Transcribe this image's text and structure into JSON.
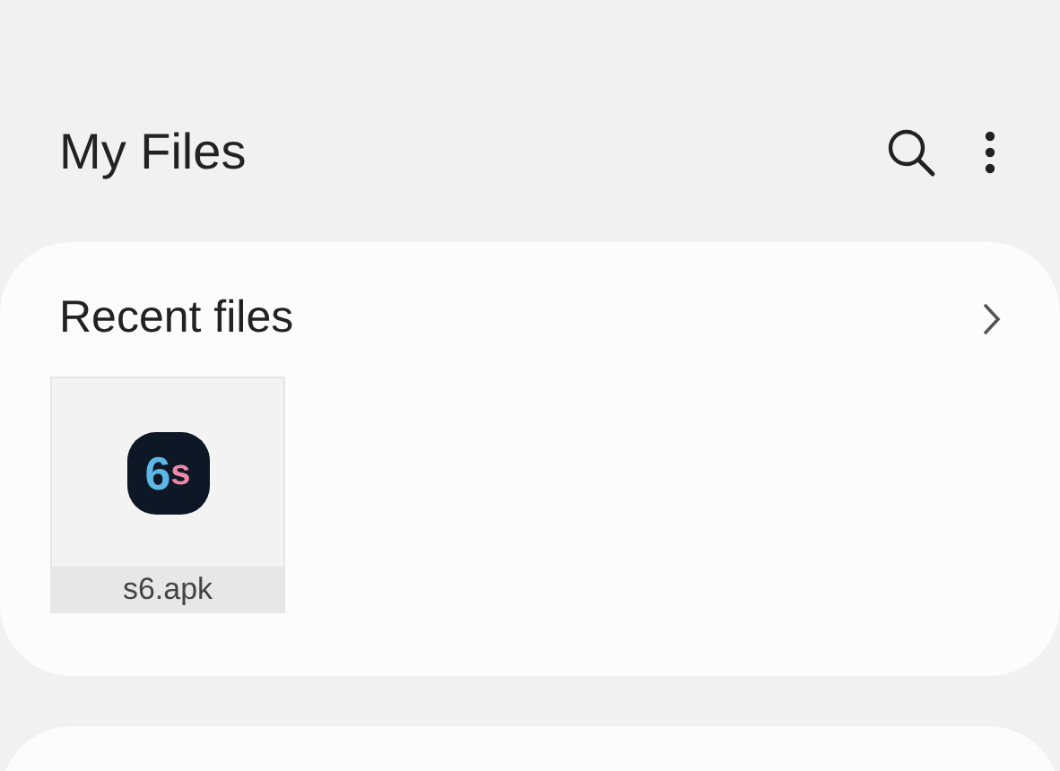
{
  "header": {
    "title": "My Files"
  },
  "recent": {
    "title": "Recent files",
    "files": [
      {
        "name": "s6.apk",
        "icon_text": [
          {
            "text": "6",
            "color": "#5cb6e6"
          },
          {
            "text": "s",
            "color": "#ef88a6"
          }
        ]
      }
    ]
  }
}
